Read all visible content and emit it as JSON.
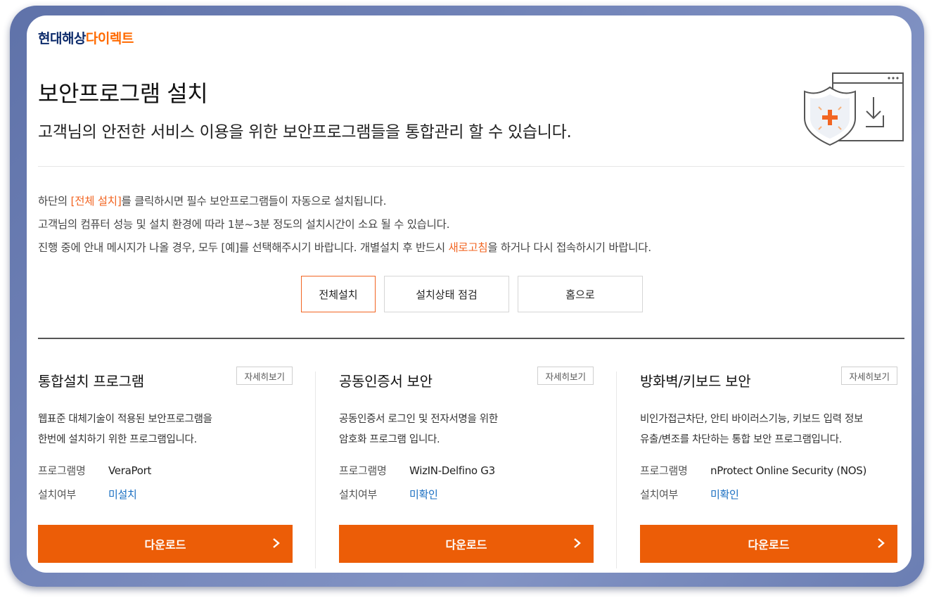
{
  "brand": {
    "part1": "현대해상",
    "part2": "다이렉트"
  },
  "header": {
    "title": "보안프로그램 설치",
    "subtitle": "고객님의 안전한 서비스 이용을 위한 보안프로그램들을 통합관리 할 수 있습니다.",
    "hero_icon": "shield-download-icon"
  },
  "notice": {
    "line1_pre": "하단의 ",
    "line1_hl": "[전체 설치]",
    "line1_post": "를 클릭하시면 필수 보안프로그램들이 자동으로 설치됩니다.",
    "line2": "고객님의 컴퓨터 성능 및 설치 환경에 따라 1분~3분 정도의 설치시간이 소요 될 수 있습니다.",
    "line3_pre": "진행 중에 안내 메시지가 나올 경우, 모두 [예]를 선택해주시기 바랍니다. 개별설치 후 반드시 ",
    "line3_hl": "새로고침",
    "line3_post": "을 하거나 다시 접속하시기 바랍니다."
  },
  "actions": {
    "install_all": "전체설치",
    "check_status": "설치상태 점검",
    "home": "홈으로"
  },
  "cards": [
    {
      "title": "통합설치 프로그램",
      "more": "자세히보기",
      "desc1": "웹표준 대체기술이 적용된 보안프로그램을",
      "desc2": "한번에 설치하기 위한 프로그램입니다.",
      "name_label": "프로그램명",
      "name_value": "VeraPort",
      "status_label": "설치여부",
      "status_value": "미설치",
      "download": "다운로드"
    },
    {
      "title": "공동인증서 보안",
      "more": "자세히보기",
      "desc1": "공동인증서 로그인 및 전자서명을 위한",
      "desc2": "암호화 프로그램 입니다.",
      "name_label": "프로그램명",
      "name_value": "WizIN-Delfino G3",
      "status_label": "설치여부",
      "status_value": "미확인",
      "download": "다운로드"
    },
    {
      "title": "방화벽/키보드 보안",
      "more": "자세히보기",
      "desc1": "비인가접근차단, 안티 바이러스기능, 키보드 입력 정보",
      "desc2": "유출/변조를 차단하는 통합 보안 프로그램입니다.",
      "name_label": "프로그램명",
      "name_value": "nProtect Online Security (NOS)",
      "status_label": "설치여부",
      "status_value": "미확인",
      "download": "다운로드"
    }
  ],
  "colors": {
    "brand_navy": "#0d2b6b",
    "brand_orange": "#ff6a00",
    "download_button": "#ec5d07",
    "status_link": "#1a6fc2",
    "highlight": "#f26522"
  }
}
